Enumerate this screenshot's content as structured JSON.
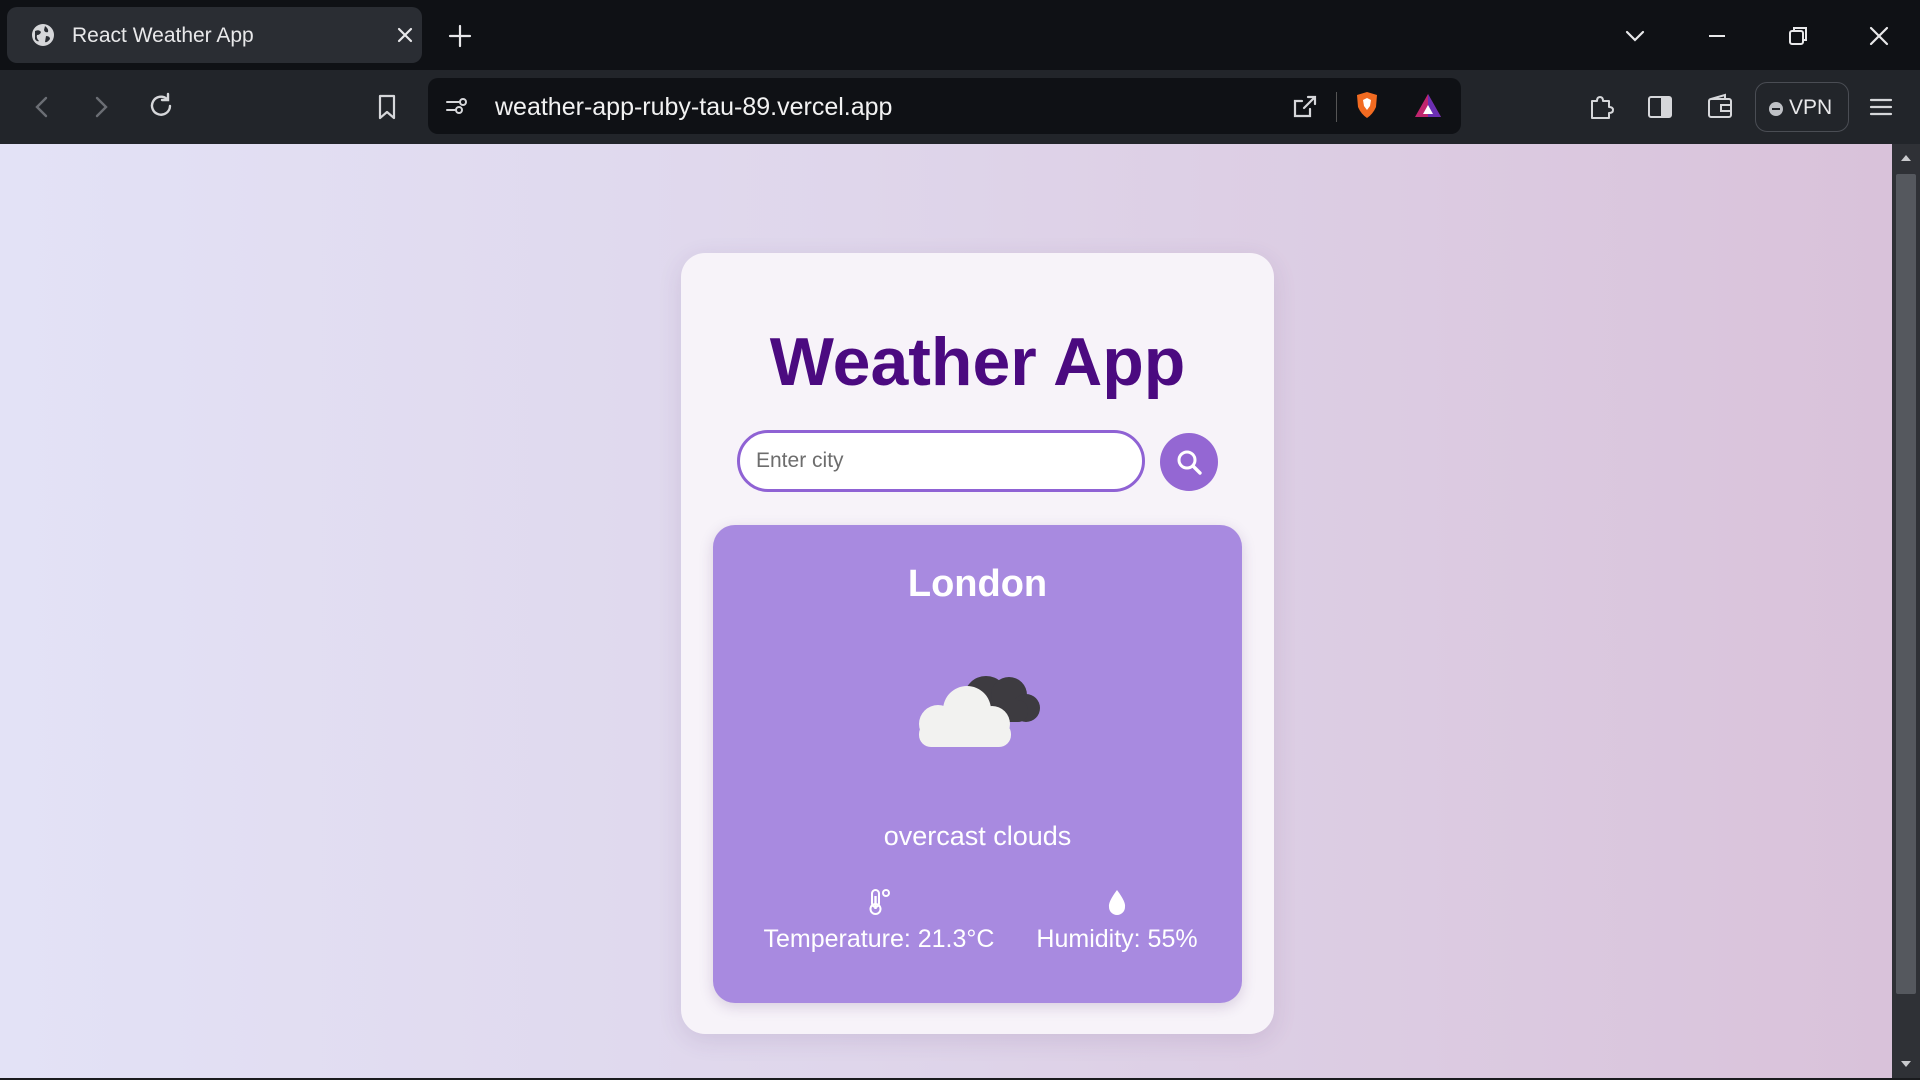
{
  "browser": {
    "tab_title": "React Weather App",
    "url": "weather-app-ruby-tau-89.vercel.app",
    "vpn_label": "VPN"
  },
  "app": {
    "title": "Weather App",
    "search_placeholder": "Enter city",
    "search_value": "",
    "weather": {
      "city": "London",
      "condition": "overcast clouds",
      "temperature_text": "Temperature: 21.3°C",
      "humidity_text": "Humidity: 55%",
      "icon": "overcast-clouds-icon"
    }
  },
  "colors": {
    "accent": "#9467d3",
    "title": "#4b0a80",
    "panel": "#a88ae0"
  }
}
